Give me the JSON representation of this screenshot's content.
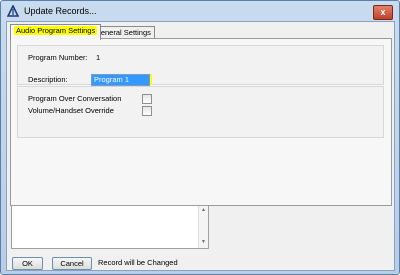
{
  "window": {
    "title": "Update Records...",
    "close_label": "x"
  },
  "tabs": [
    {
      "label": "Audio Program Settings",
      "active": true
    },
    {
      "label": "General Settings",
      "active": false
    }
  ],
  "program": {
    "number_label": "Program Number:",
    "number_value": "1",
    "description_label": "Description:",
    "description_value": "Program 1"
  },
  "options": {
    "over_conversation_label": "Program Over Conversation",
    "over_conversation_checked": false,
    "volume_override_label": "Volume/Handset Override",
    "volume_override_checked": false
  },
  "memo": {
    "text": "",
    "scroll_up": "▲",
    "scroll_down": "▼"
  },
  "footer": {
    "ok_label": "OK",
    "cancel_label": "Cancel",
    "status_text": "Record will be Changed"
  },
  "colors": {
    "highlight": "#ffff00",
    "selection": "#3399ff",
    "window_frame": "#b8cde6",
    "close_button": "#c0412a"
  }
}
